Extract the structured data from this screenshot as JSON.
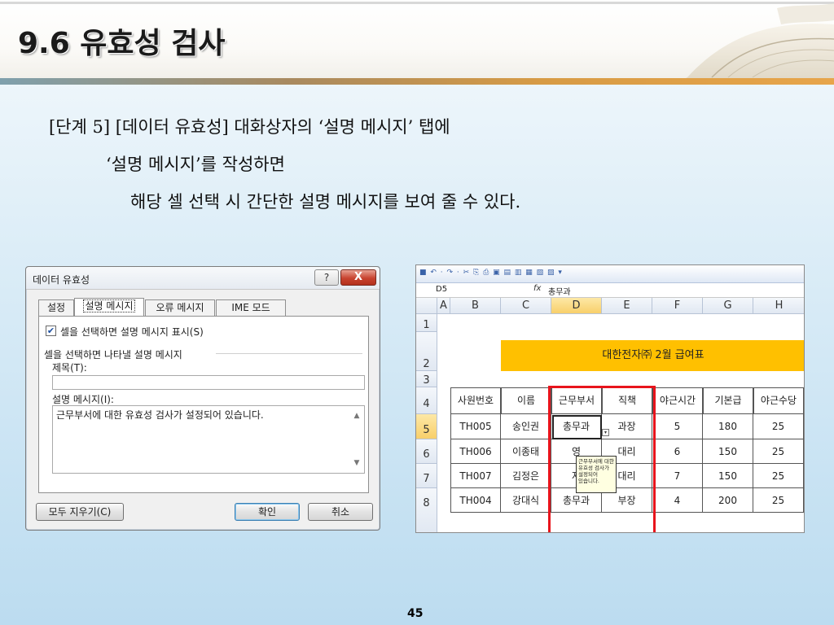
{
  "slide": {
    "title": "9.6 유효성 검사",
    "lines": [
      "[단계 5] [데이터 유효성] 대화상자의 ‘설명 메시지’ 탭에",
      "‘설명 메시지’를 작성하면",
      "해당 셀 선택 시 간단한 설명 메시지를 보여 줄 수 있다."
    ],
    "page_number": "45"
  },
  "dialog": {
    "title": "데이터 유효성",
    "help_label": "?",
    "close_label": "X",
    "tabs": [
      {
        "label": "설정",
        "active": false
      },
      {
        "label": "설명 메시지",
        "active": true
      },
      {
        "label": "오류 메시지",
        "active": false
      },
      {
        "label": "IME 모드",
        "active": false
      }
    ],
    "show_checkbox_label": "셀을 선택하면 설명 메시지 표시(S)",
    "show_checkbox_checked": true,
    "group_label": "셀을 선택하면 나타낼 설명 메시지",
    "title_field_label": "제목(T):",
    "title_field_value": "",
    "message_field_label": "설명 메시지(I):",
    "message_field_value": "근무부서에 대한 유효성 검사가 설정되어 있습니다.",
    "clear_all_label": "모두 지우기(C)",
    "ok_label": "확인",
    "cancel_label": "취소"
  },
  "excel": {
    "toolbar_icons": "■ ↶ · ↷ · ✂ ⎘ ⎙ ▣ ▤ ▥ ▦ ▧ ▨ ▾",
    "name_box": "D5",
    "formula_value": "총무과",
    "columns": [
      "A",
      "B",
      "C",
      "D",
      "E",
      "F",
      "G",
      "H"
    ],
    "rows": [
      "1",
      "2",
      "3",
      "4",
      "5",
      "6",
      "7",
      "8"
    ],
    "banner": "대한전자㈜ 2월 급여표",
    "table_headers": [
      "사원번호",
      "이름",
      "근무부서",
      "직책",
      "야근시간",
      "기본급",
      "야근수당"
    ],
    "table_rows": [
      [
        "TH005",
        "송인권",
        "총무과",
        "과장",
        "5",
        "180",
        "25"
      ],
      [
        "TH006",
        "이종태",
        "영",
        "대리",
        "6",
        "150",
        "25"
      ],
      [
        "TH007",
        "김정은",
        "자",
        "대리",
        "7",
        "150",
        "25"
      ],
      [
        "TH004",
        "강대식",
        "총무과",
        "부장",
        "4",
        "200",
        "25"
      ]
    ],
    "tooltip_lines": [
      "근무부서에 대한",
      "유효성 검사가",
      "설정되어",
      "있습니다."
    ]
  }
}
